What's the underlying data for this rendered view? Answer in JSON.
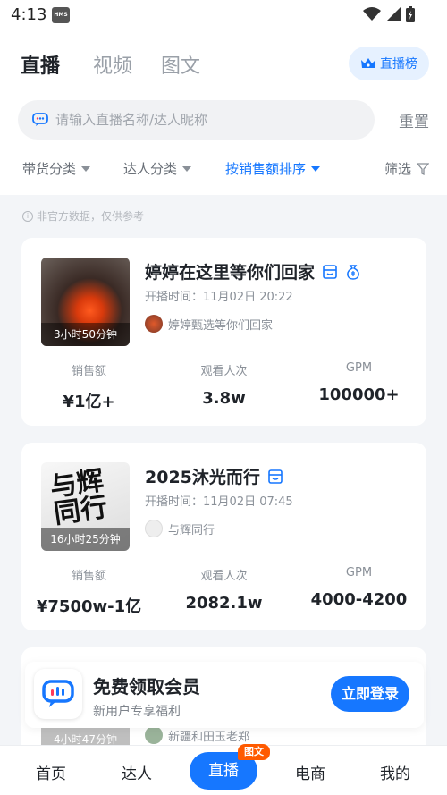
{
  "status_bar": {
    "time": "4:13",
    "hms": "HMS"
  },
  "header": {
    "tabs": [
      {
        "label": "直播",
        "active": true
      },
      {
        "label": "视频",
        "active": false
      },
      {
        "label": "图文",
        "active": false
      }
    ],
    "rank_button": "直播榜"
  },
  "search": {
    "placeholder": "请输入直播名称/达人昵称",
    "value": "",
    "reset_label": "重置"
  },
  "filters": [
    {
      "label": "带货分类"
    },
    {
      "label": "达人分类"
    },
    {
      "label": "按销售额排序",
      "active": true
    },
    {
      "label": "筛选"
    }
  ],
  "notice": "非官方数据，仅供参考",
  "stat_labels": {
    "sales": "销售额",
    "viewers": "观看人次",
    "gpm": "GPM"
  },
  "cards": [
    {
      "title": "婷婷在这里等你们回家",
      "time": "开播时间：11月02日 20:22",
      "shop": "婷婷甄选等你们回家",
      "duration": "3小时50分钟",
      "sales": "¥1亿+",
      "viewers": "3.8w",
      "gpm": "100000+"
    },
    {
      "title": "2025沐光而行",
      "time": "开播时间：11月02日 07:45",
      "shop": "与辉同行",
      "duration": "16小时25分钟",
      "thumb_text": "与辉同行",
      "sales": "¥7500w-1亿",
      "viewers": "2082.1w",
      "gpm": "4000-4200"
    },
    {
      "shop": "新疆和田玉老郑",
      "duration": "4小时47分钟"
    }
  ],
  "promo": {
    "title": "免费领取会员",
    "subtitle": "新用户专享福利",
    "button": "立即登录"
  },
  "nav": [
    {
      "label": "首页"
    },
    {
      "label": "达人"
    },
    {
      "label": "直播",
      "active": true,
      "badge": "图文"
    },
    {
      "label": "电商"
    },
    {
      "label": "我的"
    }
  ],
  "colors": {
    "accent": "#1677ff",
    "badge": "#ff5a00"
  }
}
